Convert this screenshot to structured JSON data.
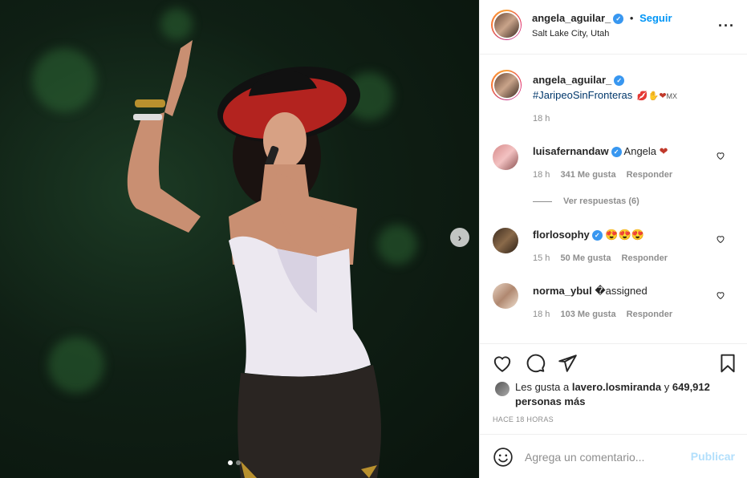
{
  "post": {
    "username": "angela_aguilar_",
    "follow_label": "Seguir",
    "bullet": "•",
    "location": "Salt Lake City, Utah",
    "more_icon": "more-horizontal-icon"
  },
  "caption": {
    "username": "angela_aguilar_",
    "hashtag": "#JaripeoSinFronteras",
    "emojis": "💋✋❤",
    "mx_flag": "MX",
    "time": "18 h"
  },
  "comments": [
    {
      "username": "luisafernandaw",
      "verified": true,
      "text": "Angela",
      "emoji": "❤",
      "time": "18 h",
      "likes": "341 Me gusta",
      "reply": "Responder",
      "view_replies": "Ver respuestas (6)"
    },
    {
      "username": "florlosophy",
      "verified": true,
      "text": "",
      "emoji": "😍😍😍",
      "time": "15 h",
      "likes": "50 Me gusta",
      "reply": "Responder"
    },
    {
      "username": "norma_ybul",
      "verified": false,
      "text": "�assigned",
      "emoji": "",
      "time": "18 h",
      "likes": "103 Me gusta",
      "reply": "Responder"
    }
  ],
  "likes": {
    "prefix": "Les gusta a",
    "user": "lavero.losmiranda",
    "mid": "y",
    "count": "649,912 personas más"
  },
  "post_time": "HACE 18 HORAS",
  "add_comment": {
    "placeholder": "Agrega un comentario...",
    "publish": "Publicar"
  },
  "carousel": {
    "slides": 2,
    "active": 0,
    "next_icon": "chevron-right-icon"
  },
  "colors": {
    "link": "#0095f6",
    "hashtag": "#00376b",
    "muted": "#8e8e8e",
    "publish_disabled": "#b2dffc",
    "verified": "#3897f0"
  }
}
